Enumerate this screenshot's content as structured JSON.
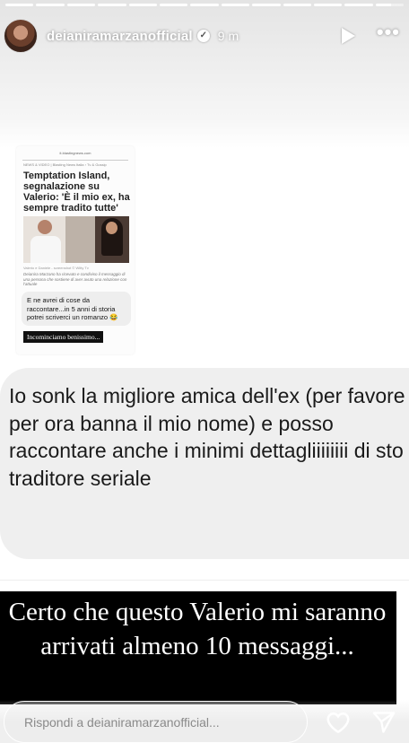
{
  "story": {
    "progress": {
      "segments": 13,
      "completed": 12,
      "current_fraction": 0.55
    },
    "username": "deianiramarzanofficial",
    "verified_icon": "verified-badge-icon",
    "time": "9 m",
    "controls": {
      "play": "play-icon",
      "more": "more-icon"
    }
  },
  "article": {
    "url": "it.blastingnews.com",
    "crumb": "NEWS & VIDEO | Blasting News Italia › Tv & Gossip",
    "title": "Temptation Island, segnalazione su Valerio: 'È il mio ex, ha sempre tradito tutte'",
    "photo_caption": "Valerio e Daniele - screenshot © Witty Tv",
    "summary": "Deianira Marzano ha ricevuto e condiviso il messaggio di una persona che sostiene di aver avuto una relazione con l'attuale",
    "reply_bubble": "E ne avrei di cose da raccontare...in 5 anni di storia potrei scriverci un romanzo 😂",
    "tag": "Incominciamo benissimo..."
  },
  "message": {
    "text": "Io sonk la migliore amica dell'ex (per favore per ora banna il mio nome) e posso raccontare anche i minimi dettagliiiiiiii di sto traditore seriale"
  },
  "caption": {
    "text": "Certo che questo Valerio mi saranno arrivati almeno 10 messaggi..."
  },
  "reply": {
    "placeholder": "Rispondi a deianiramarzanofficial...",
    "like_icon": "heart-icon",
    "send_icon": "send-icon"
  }
}
